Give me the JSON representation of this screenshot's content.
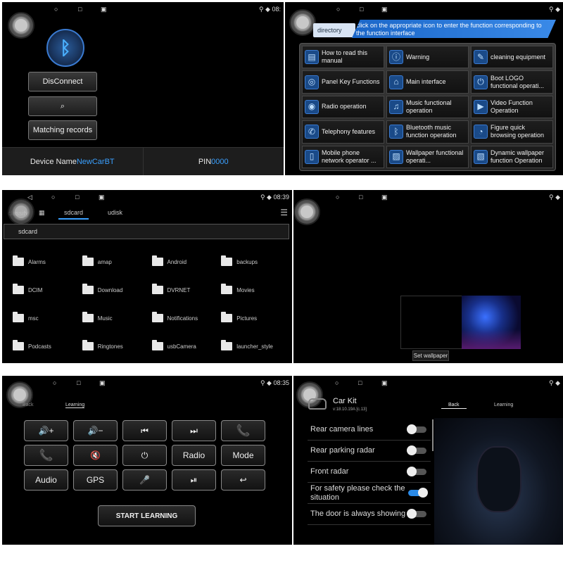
{
  "status": {
    "nav_back": "◁",
    "nav_home": "○",
    "nav_recent": "□",
    "p1_time": "08:",
    "p3_time": "08:39",
    "p5_time": "08:35"
  },
  "bluetooth": {
    "disconnect_label": "DisConnect",
    "matching_records_label": "Matching records",
    "device_name_label": "Device Name",
    "device_name_value": "NewCarBT",
    "pin_label": "PIN",
    "pin_value": "0000"
  },
  "manual": {
    "directory_label": "directory",
    "banner_text": "click on the appropriate icon to enter the function corresponding to the function interface",
    "tiles": [
      {
        "label": "How to read this manual",
        "icon": "book-icon"
      },
      {
        "label": "Warning",
        "icon": "warning-icon"
      },
      {
        "label": "cleaning equipment",
        "icon": "brush-icon"
      },
      {
        "label": "Panel Key Functions",
        "icon": "panel-icon"
      },
      {
        "label": "Main interface",
        "icon": "home-icon"
      },
      {
        "label": "Boot LOGO functional operati...",
        "icon": "power-icon"
      },
      {
        "label": "Radio operation",
        "icon": "radio-icon"
      },
      {
        "label": "Music functional operation",
        "icon": "music-icon"
      },
      {
        "label": "Video Function Operation",
        "icon": "play-icon"
      },
      {
        "label": "Telephony features",
        "icon": "phone-icon"
      },
      {
        "label": "Bluetooth music function operation",
        "icon": "bluetooth-icon"
      },
      {
        "label": "Figure quick browsing operation",
        "icon": "gauge-icon"
      },
      {
        "label": "Mobile phone network operator ...",
        "icon": "mobile-icon"
      },
      {
        "label": "Wallpaper functional operati...",
        "icon": "image-icon"
      },
      {
        "label": "Dynamic wallpaper function Operation",
        "icon": "wallpaper-icon"
      }
    ]
  },
  "files": {
    "classify_label": "classify",
    "tab_sdcard": "sdcard",
    "tab_udisk": "udisk",
    "path": "sdcard",
    "folders": [
      "Alarms",
      "amap",
      "Android",
      "backups",
      "DCIM",
      "Download",
      "DVRNET",
      "Movies",
      "msc",
      "Music",
      "Notifications",
      "Pictures",
      "Podcasts",
      "Ringtones",
      "usbCamera",
      "launcher_style"
    ]
  },
  "wallpaper": {
    "set_wallpaper_label": "Set wallpaper"
  },
  "steering": {
    "back_label": "Back",
    "learning_label": "Learning",
    "keys": [
      "🔊+",
      "🔊−",
      "⏮",
      "⏭",
      "📞",
      "📞",
      "🔇",
      "⏻",
      "Radio",
      "Mode",
      "Audio",
      "GPS",
      "🎤",
      "⏯",
      "↩"
    ],
    "start_learning_label": "START LEARNING"
  },
  "carkit": {
    "title": "Car Kit",
    "version": "v:18.10.19A [c.13]",
    "back_label": "Back",
    "learning_label": "Learning",
    "settings": [
      {
        "label": "Rear camera lines",
        "on": false
      },
      {
        "label": "Rear parking radar",
        "on": false
      },
      {
        "label": "Front radar",
        "on": false
      },
      {
        "label": "For safety please check the situation",
        "on": true
      },
      {
        "label": "The door is always showing",
        "on": false
      }
    ],
    "accent_color": "#2a8ae8"
  }
}
